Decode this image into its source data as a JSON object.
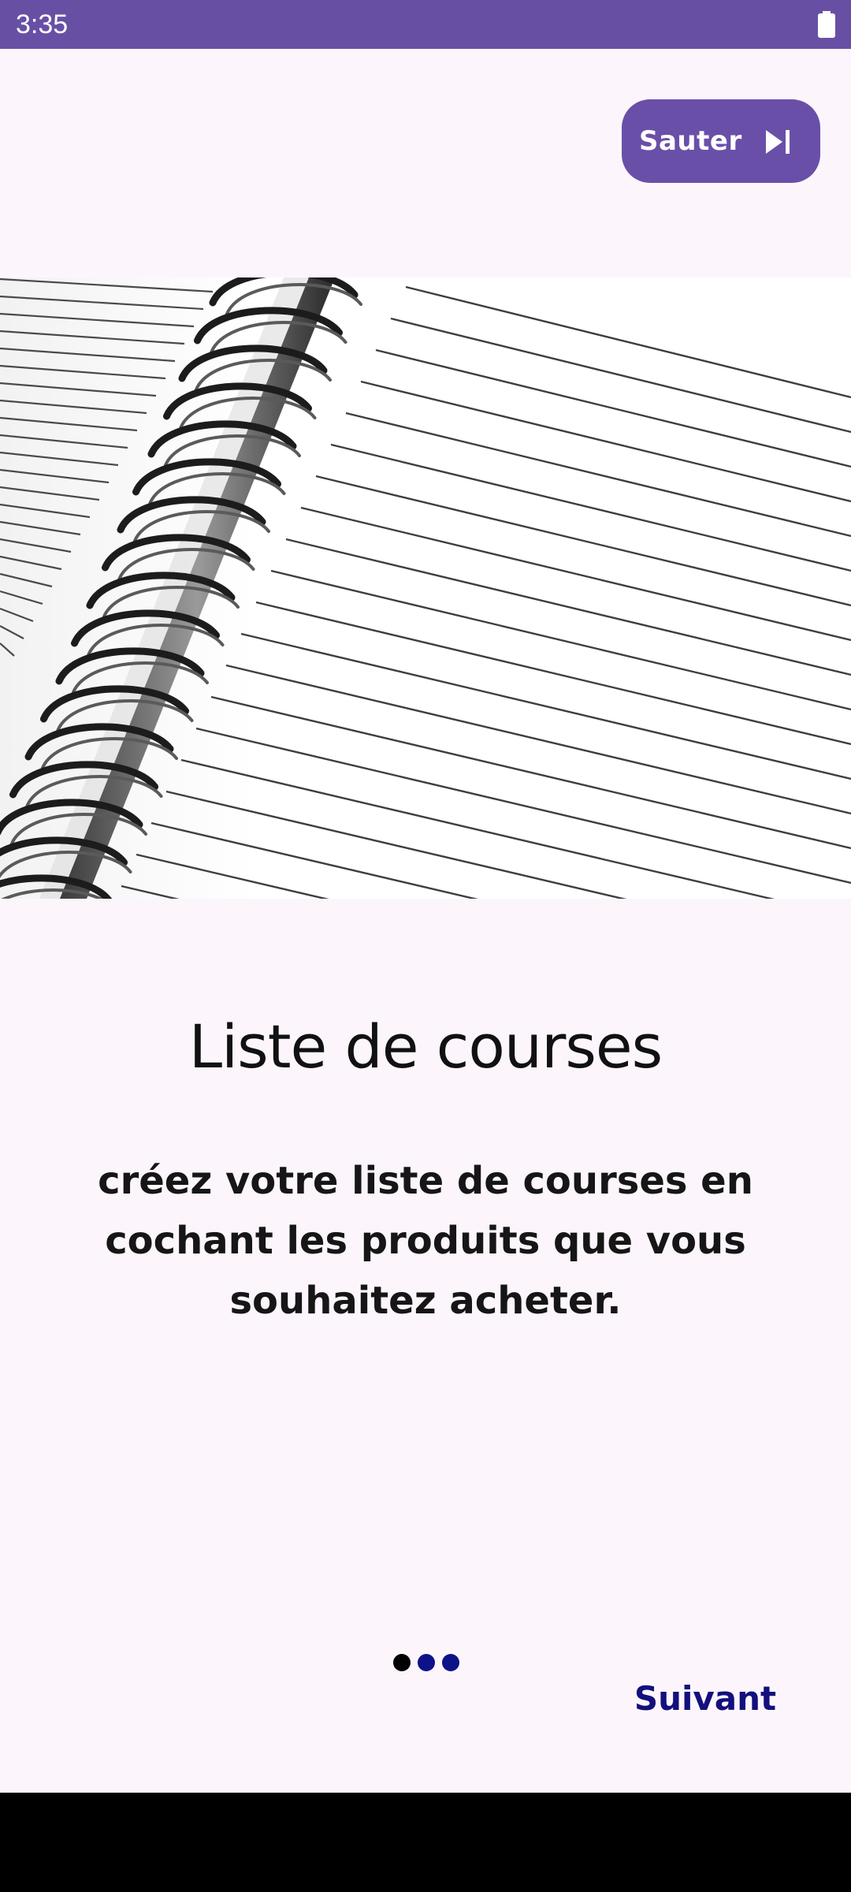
{
  "status_bar": {
    "time": "3:35",
    "battery_icon": "battery-full-icon"
  },
  "skip_button": {
    "label": "Sauter",
    "icon": "skip-next-icon"
  },
  "hero": {
    "image": "spiral-notebook-lined-pages"
  },
  "onboarding": {
    "title": "Liste de courses",
    "description": "créez votre liste de courses en cochant les produits que vous souhaitez acheter."
  },
  "pager": {
    "dot_colors": [
      "#000000",
      "#0d1288",
      "#0d1288"
    ]
  },
  "next_button": {
    "label": "Suivant"
  },
  "colors": {
    "primary": "#6750a4",
    "accent_text": "#13107e"
  }
}
